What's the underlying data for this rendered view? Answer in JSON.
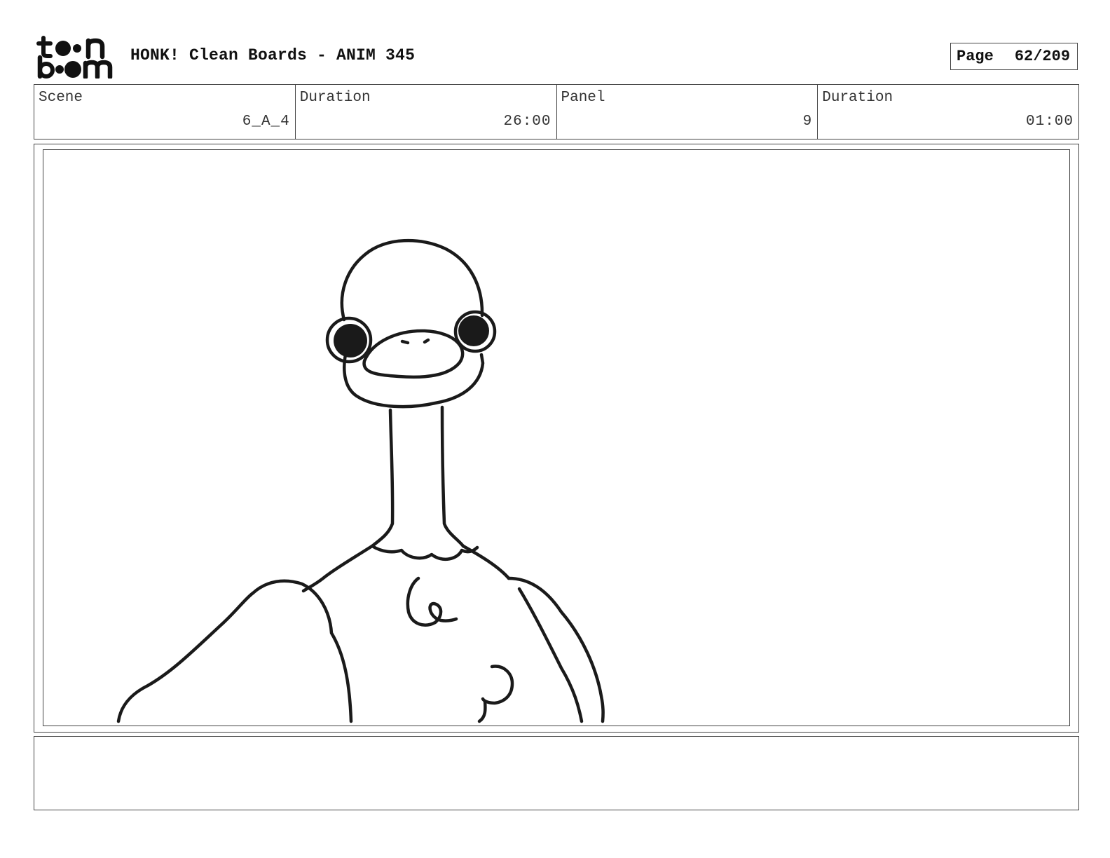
{
  "header": {
    "logo_icon": "toon-boom-logo-icon",
    "logo_top": "t  n",
    "logo_bottom": "b  m",
    "title": "HONK! Clean Boards - ANIM 345",
    "page_label": "Page",
    "page_value": "62/209"
  },
  "info": [
    {
      "label": "Scene",
      "value": "6_A_4"
    },
    {
      "label": "Duration",
      "value": "26:00"
    },
    {
      "label": "Panel",
      "value": "9"
    },
    {
      "label": "Duration",
      "value": "01:00"
    }
  ],
  "drawing": {
    "subject": "goose-drawing",
    "line_color": "#1a1a1a"
  },
  "notes": {
    "text": ""
  }
}
